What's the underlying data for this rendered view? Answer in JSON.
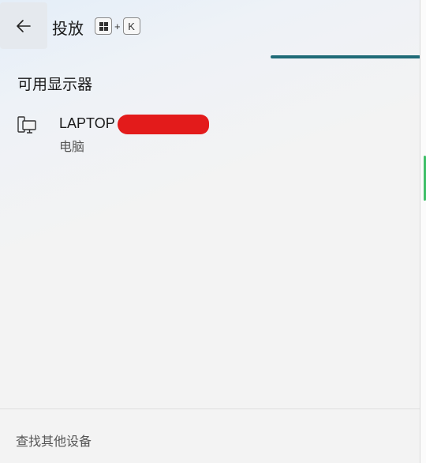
{
  "header": {
    "back_icon": "arrow-left-icon",
    "title": "投放",
    "shortcut": {
      "modifier_icon": "windows-logo-icon",
      "plus": "+",
      "key": "K"
    }
  },
  "progress": {
    "state": "indeterminate"
  },
  "section": {
    "title": "可用显示器"
  },
  "devices": [
    {
      "name": "LAPTOP",
      "type": "电脑",
      "icon": "pc-display-icon",
      "name_redacted": true
    }
  ],
  "footer": {
    "link_label": "查找其他设备"
  },
  "colors": {
    "progress": "#1f6b77",
    "redaction": "#e31b1b",
    "edge_accent": "#3fbf68"
  }
}
